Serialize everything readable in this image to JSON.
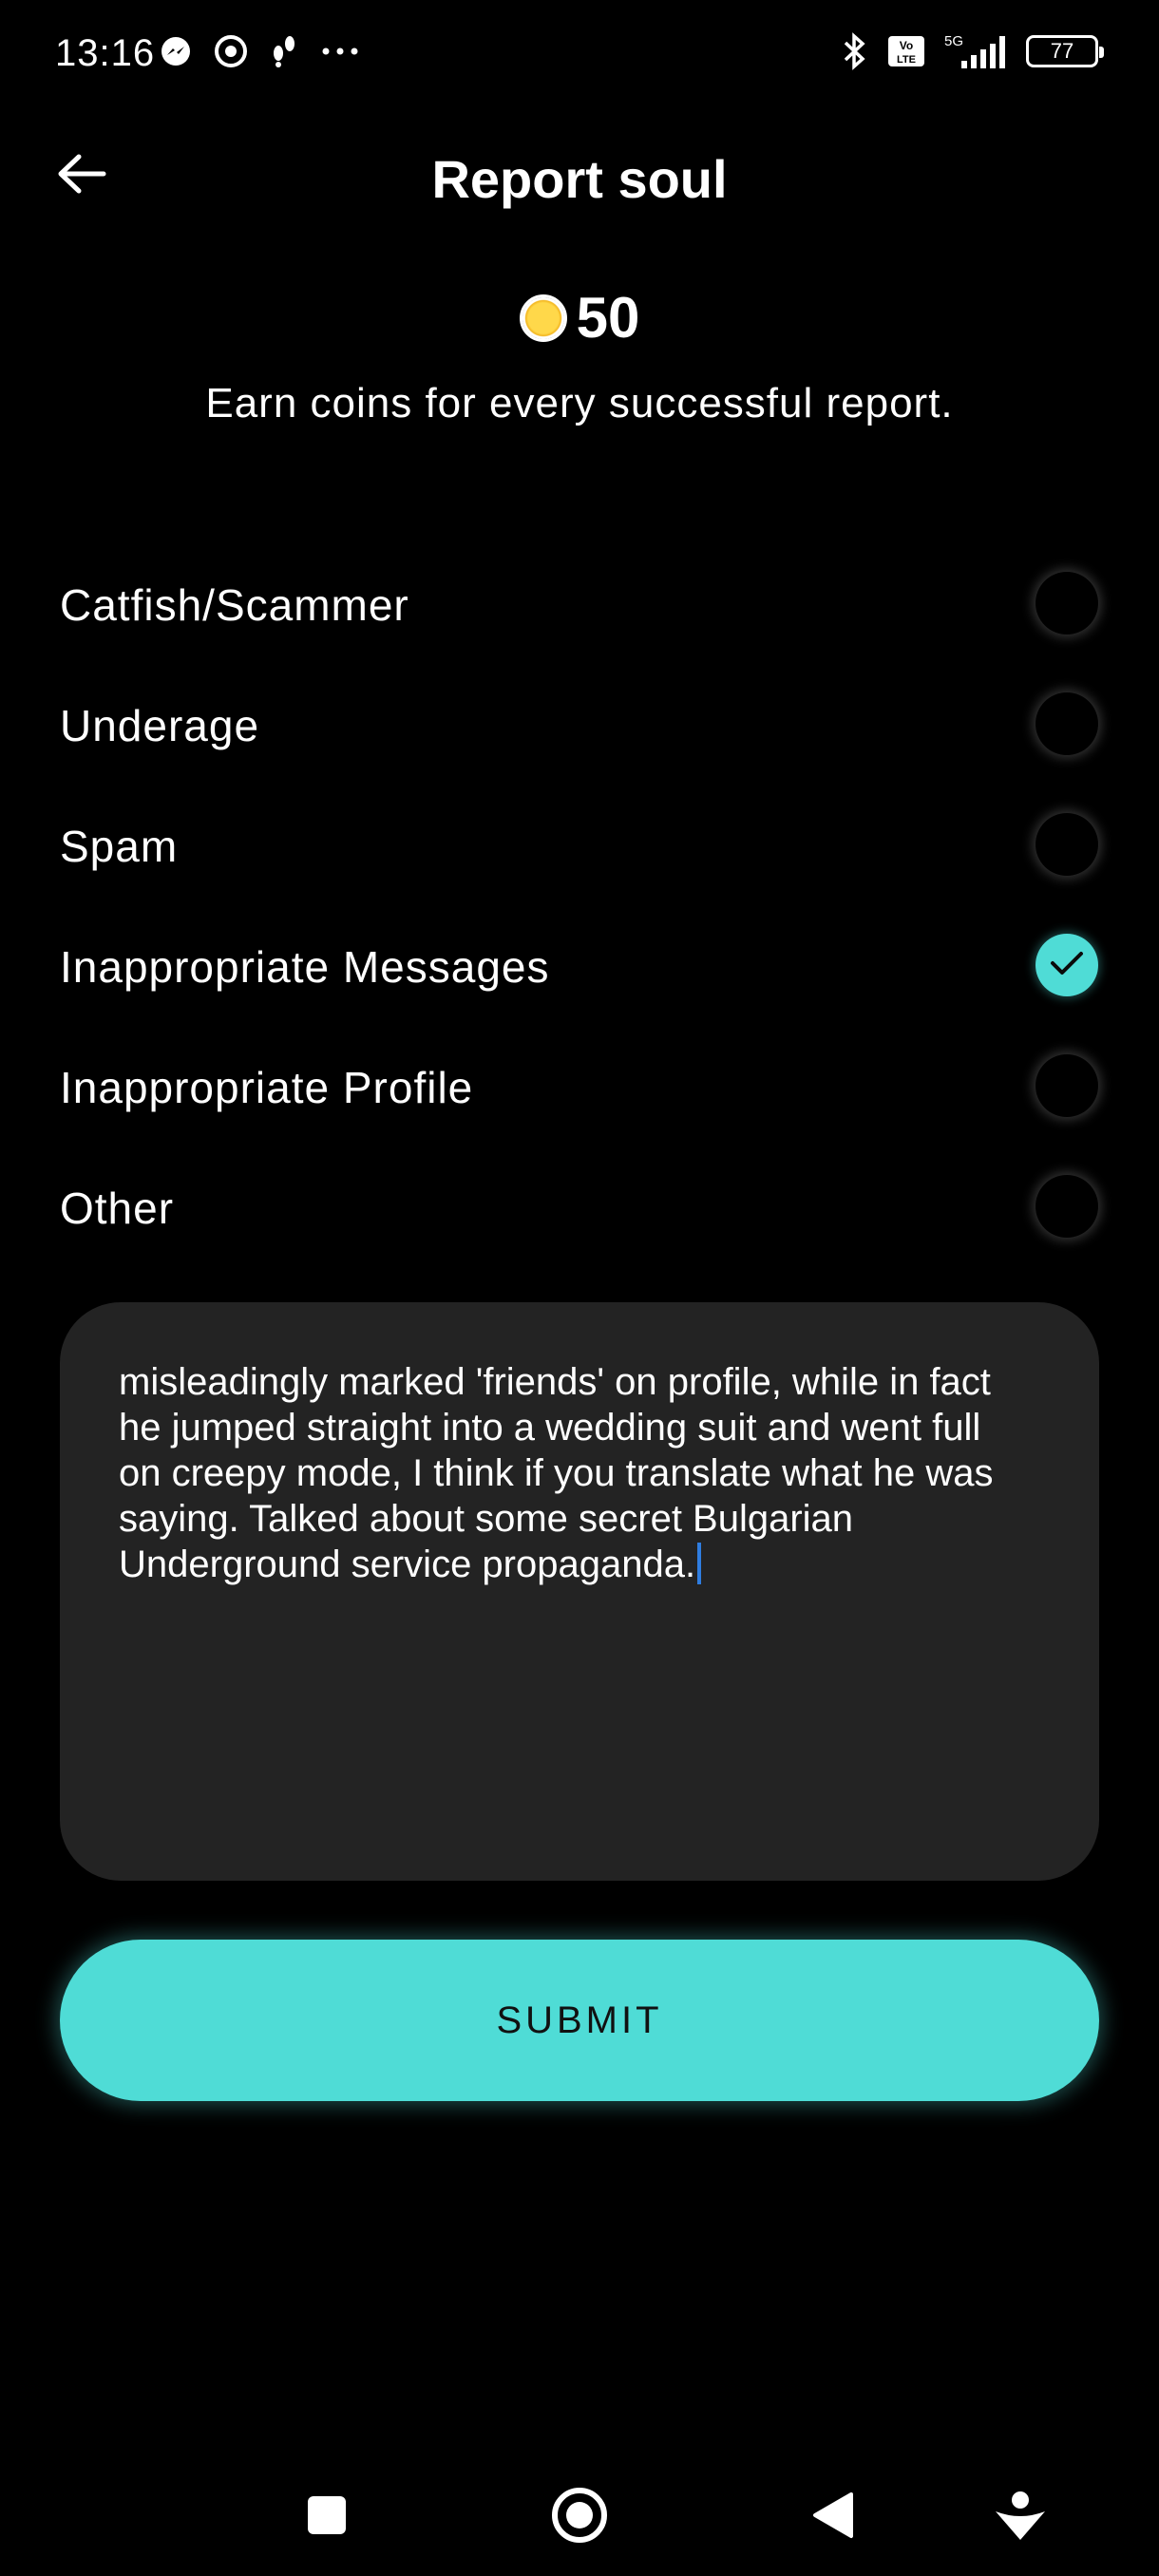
{
  "status_bar": {
    "time": "13:16",
    "left_icons": [
      "messenger-icon",
      "chrome-icon",
      "footprints-icon",
      "more-dots-icon"
    ],
    "right_icons": [
      "bluetooth-icon",
      "volte-icon",
      "signal-5g-icon"
    ],
    "network": "5G",
    "volte": "Vo LTE",
    "battery": "77"
  },
  "header": {
    "title": "Report soul",
    "back_icon": "back-arrow-icon"
  },
  "reward": {
    "coins": "50",
    "description": "Earn coins for every successful report."
  },
  "options": [
    {
      "label": "Catfish/Scammer",
      "checked": false
    },
    {
      "label": "Underage",
      "checked": false
    },
    {
      "label": "Spam",
      "checked": false
    },
    {
      "label": "Inappropriate Messages",
      "checked": true
    },
    {
      "label": "Inappropriate Profile",
      "checked": false
    },
    {
      "label": "Other",
      "checked": false
    }
  ],
  "report": {
    "text": "misleadingly marked 'friends' on profile, while in fact he jumped straight into a wedding suit and went full on creepy mode, I think if you translate what he was saying. Talked about some secret Bulgarian Underground service propaganda."
  },
  "submit": {
    "label": "SUBMIT"
  },
  "colors": {
    "accent": "#4fdcd6",
    "background": "#000000",
    "input_background": "#232323",
    "caret": "#2f7de0"
  },
  "nav_bar": [
    "square-icon",
    "home-circle-icon",
    "back-triangle-icon",
    "assistant-icon"
  ]
}
